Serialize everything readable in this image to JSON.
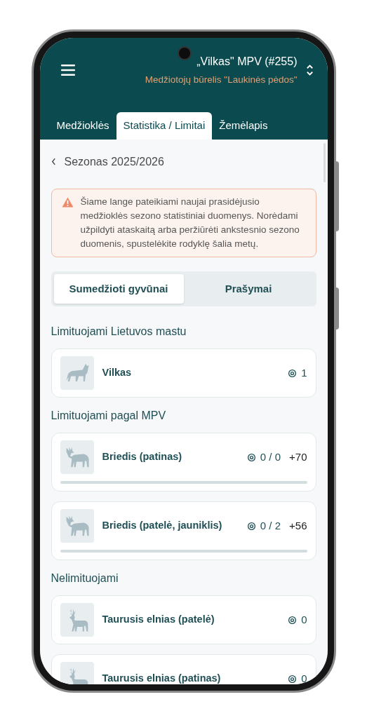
{
  "header": {
    "title": "„Vilkas\" MPV (#255)",
    "subtitle": "Medžiotojų būrelis \"Laukinės pėdos\""
  },
  "tabs": [
    {
      "label": "Medžioklės",
      "selected": false
    },
    {
      "label": "Statistika / Limitai",
      "selected": true
    },
    {
      "label": "Žemėlapis",
      "selected": false
    }
  ],
  "season": {
    "label": "Sezonas 2025/2026"
  },
  "alert": {
    "text": "Šiame lange pateikiami naujai prasidėjusio medžioklės sezono statistiniai duomenys. Norėdami užpildyti ataskaitą arba peržiūrėti ankstesnio sezono duomenis, spustelėkite rodyklę šalia metų."
  },
  "segments": [
    {
      "label": "Sumedžioti gyvūnai",
      "selected": true
    },
    {
      "label": "Prašymai",
      "selected": false
    }
  ],
  "sections": [
    {
      "title": "Limituojami Lietuvos mastu",
      "items": [
        {
          "kind": "wolf",
          "name": "Vilkas",
          "count": "1"
        }
      ]
    },
    {
      "title": "Limituojami pagal MPV",
      "items": [
        {
          "kind": "moose",
          "name": "Briedis (patinas)",
          "count": "0 / 0",
          "extra": "+70",
          "level": 0
        },
        {
          "kind": "moose",
          "name": "Briedis (patelė, jauniklis)",
          "count": "0 / 2",
          "extra": "+56",
          "level": 0
        }
      ]
    },
    {
      "title": "Nelimituojami",
      "items": [
        {
          "kind": "deer",
          "name": "Taurusis elnias (patelė)",
          "count": "0"
        },
        {
          "kind": "deer",
          "name": "Taurusis elnias (patinas)",
          "count": "0"
        }
      ]
    }
  ]
}
